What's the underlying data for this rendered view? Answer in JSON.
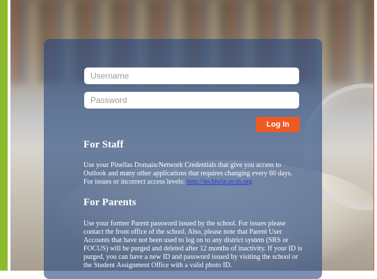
{
  "login": {
    "username_placeholder": "Username",
    "password_placeholder": "Password",
    "button_label": "Log In"
  },
  "staff": {
    "heading": "For Staff",
    "text": "Use your Pinellas Domain/Network Credentials that give you access to Outlook and many other applications that requires changing every 60 days. For issues or incorrect access levels: ",
    "link_text": "http://techhelp.pcsb.org"
  },
  "parents": {
    "heading": "For Parents",
    "text": "Use your former Parent password issued by the school. For issues please contact the front office of the school. Also, please note that Parent User Accounts that have not been used to log on to any district system (SRS or FOCUS) will be purged and deleted after 12 months of inactivity. If your ID is purged, you can have a new ID and password issued by visiting the school or the Student Assignment Office with a valid photo ID."
  },
  "colors": {
    "accent_green": "#8dbb2e",
    "login_button": "#ef5a24",
    "panel": "#264880"
  }
}
